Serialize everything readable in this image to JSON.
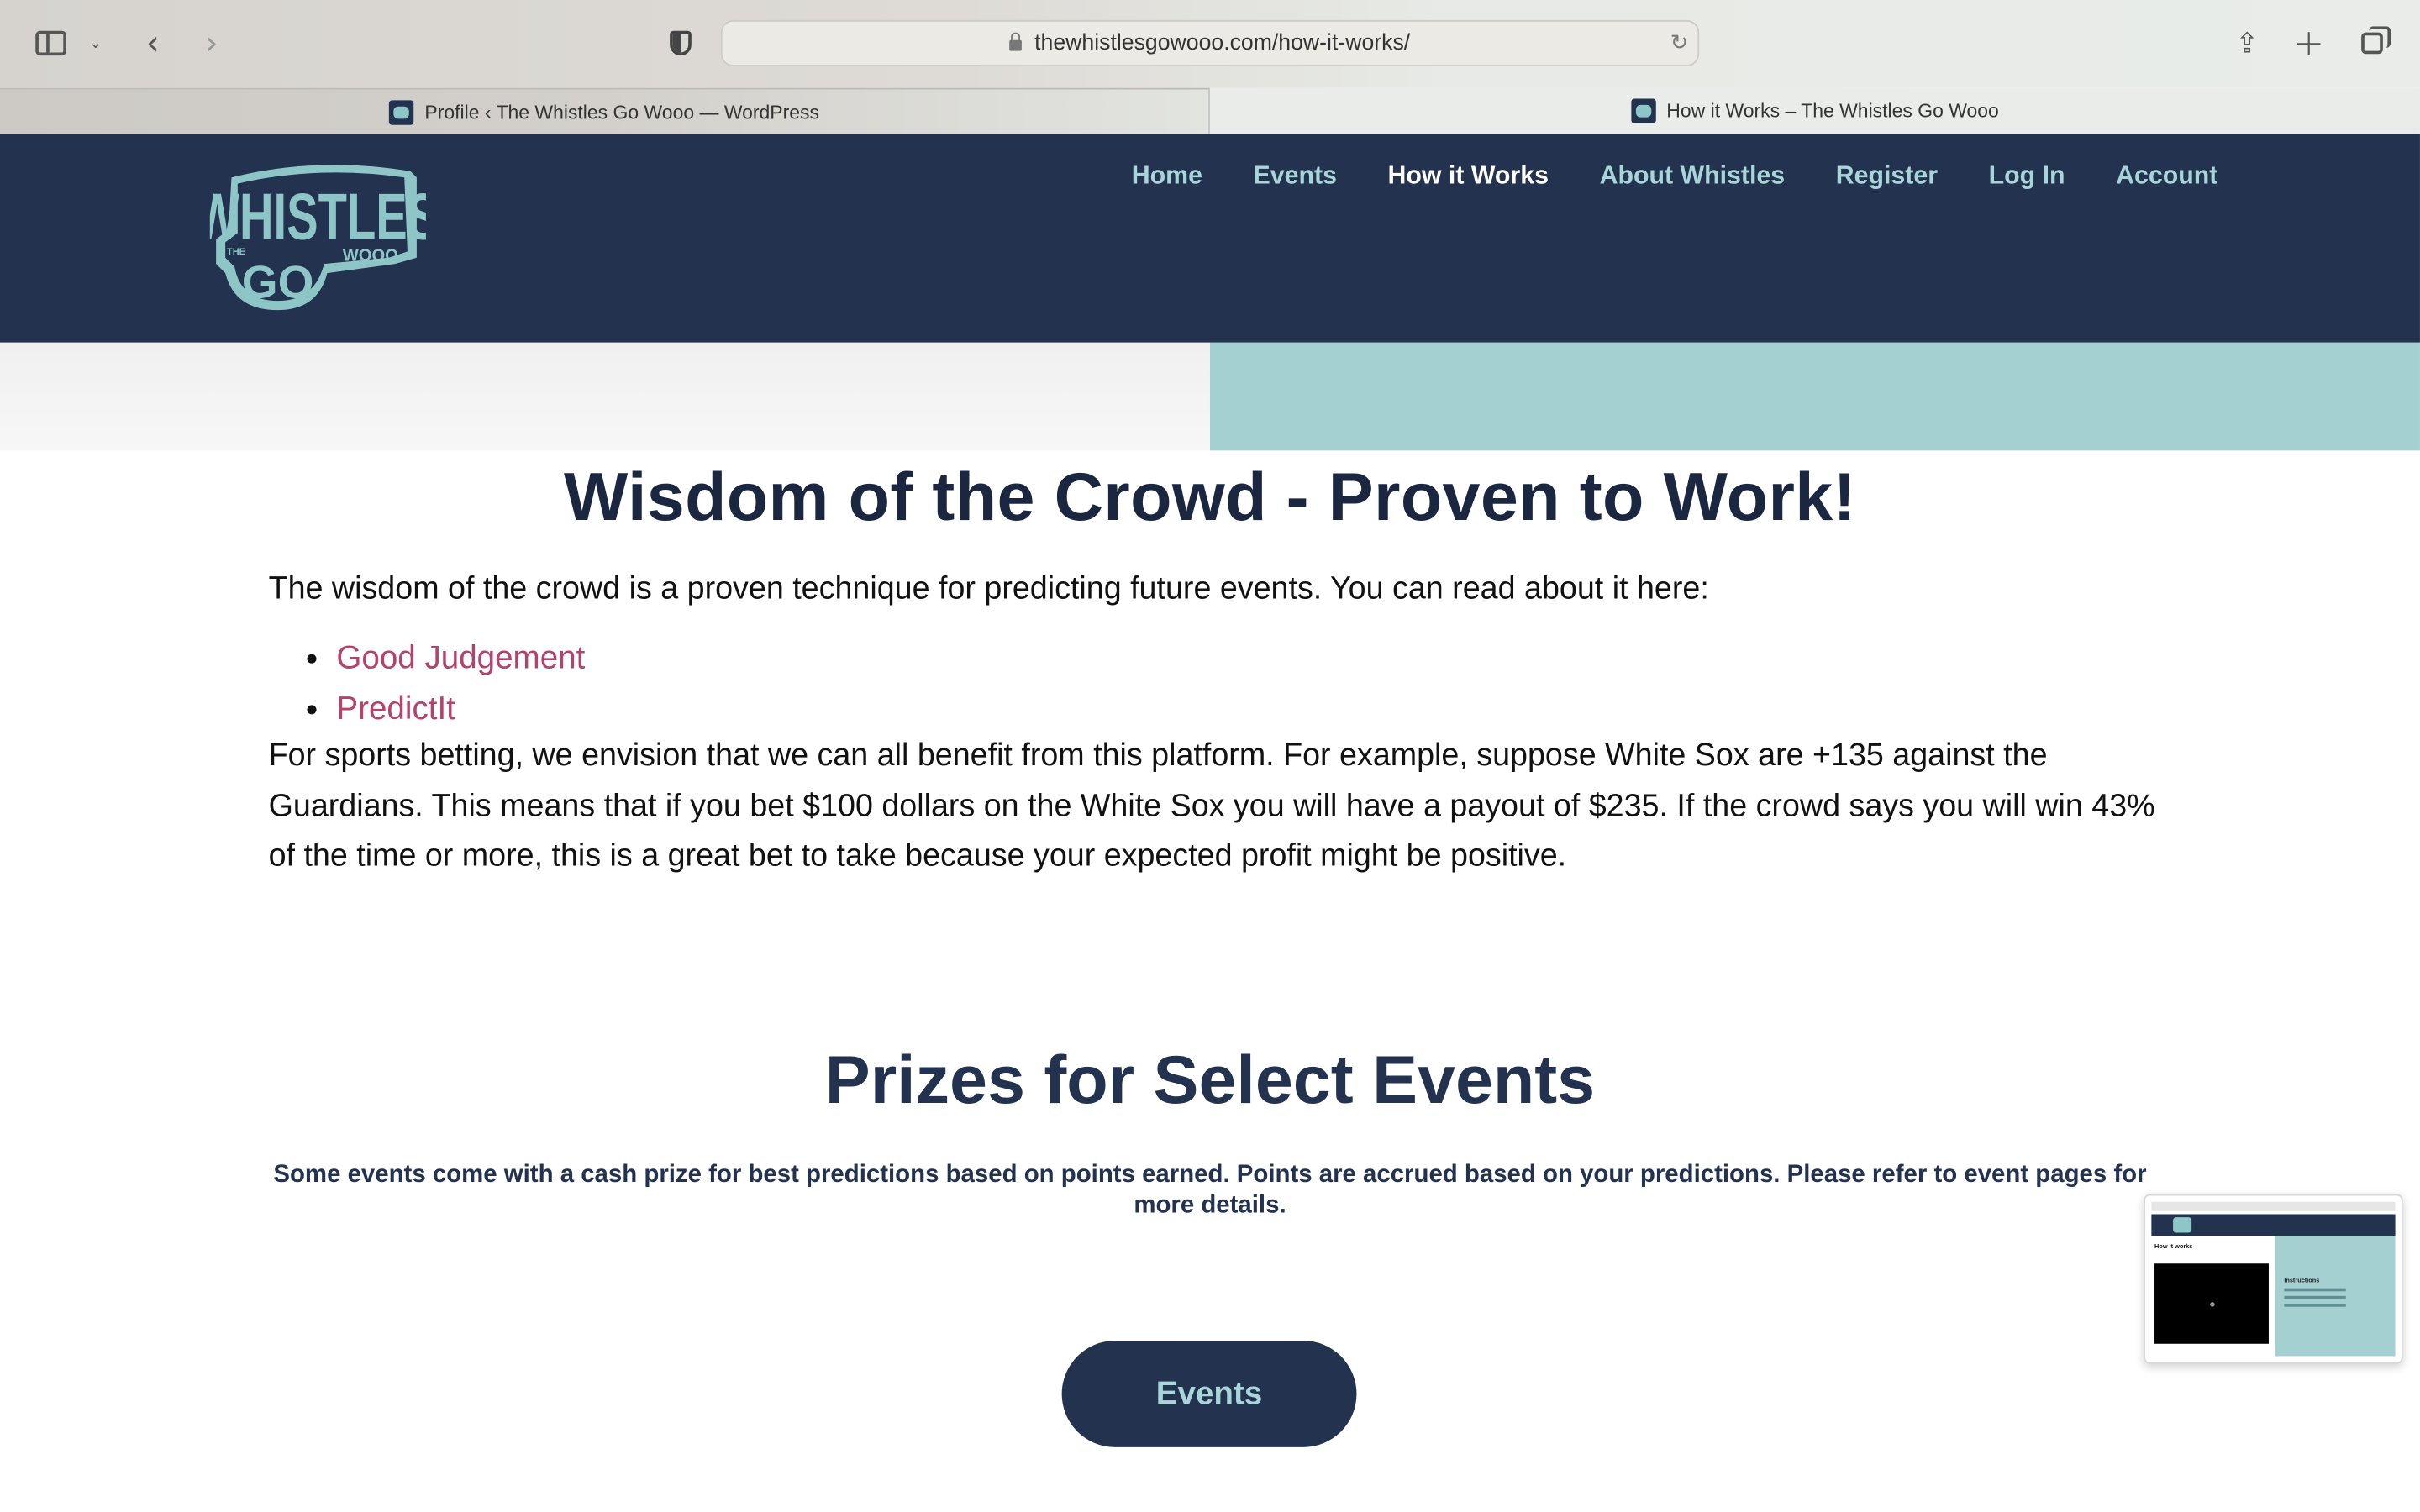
{
  "browser": {
    "url": "thewhistlesgowooo.com/how-it-works/",
    "tabs": [
      {
        "label": "Profile ‹ The Whistles Go Wooo — WordPress"
      },
      {
        "label": "How it Works – The Whistles Go Wooo"
      }
    ]
  },
  "site": {
    "logo": {
      "top": "WHISTLES",
      "the": "THE",
      "go": "GO",
      "wooo": "WOOO"
    },
    "nav": [
      {
        "label": "Home"
      },
      {
        "label": "Events"
      },
      {
        "label": "How it Works",
        "active": true
      },
      {
        "label": "About Whistles"
      },
      {
        "label": "Register"
      },
      {
        "label": "Log In"
      },
      {
        "label": "Account"
      }
    ]
  },
  "content": {
    "heading": "Wisdom of the Crowd - Proven to Work!",
    "intro": "The wisdom of the crowd is a proven technique for predicting future events. You can read about it here:",
    "links": [
      {
        "label": "Good Judgement"
      },
      {
        "label": "PredictIt"
      }
    ],
    "paragraph": "For sports betting, we envision that we can all benefit from this platform.  For example, suppose White Sox are +135 against the Guardians. This means that if you bet $100 dollars on the White Sox you will have a payout of $235.  If the crowd says you will win 43% of the time or more, this is a great bet to take because your expected profit might be positive.",
    "prizes_heading": "Prizes for Select Events",
    "prizes_text": "Some events come with a cash prize for best predictions based on points earned. Points are accrued based on your predictions. Please refer to event pages for more details.",
    "events_button": "Events"
  },
  "pip": {
    "title": "How it works",
    "instructions": "Instructions"
  },
  "colors": {
    "navy": "#22324f",
    "teal": "#a5d0d2",
    "link": "#b4426c"
  }
}
